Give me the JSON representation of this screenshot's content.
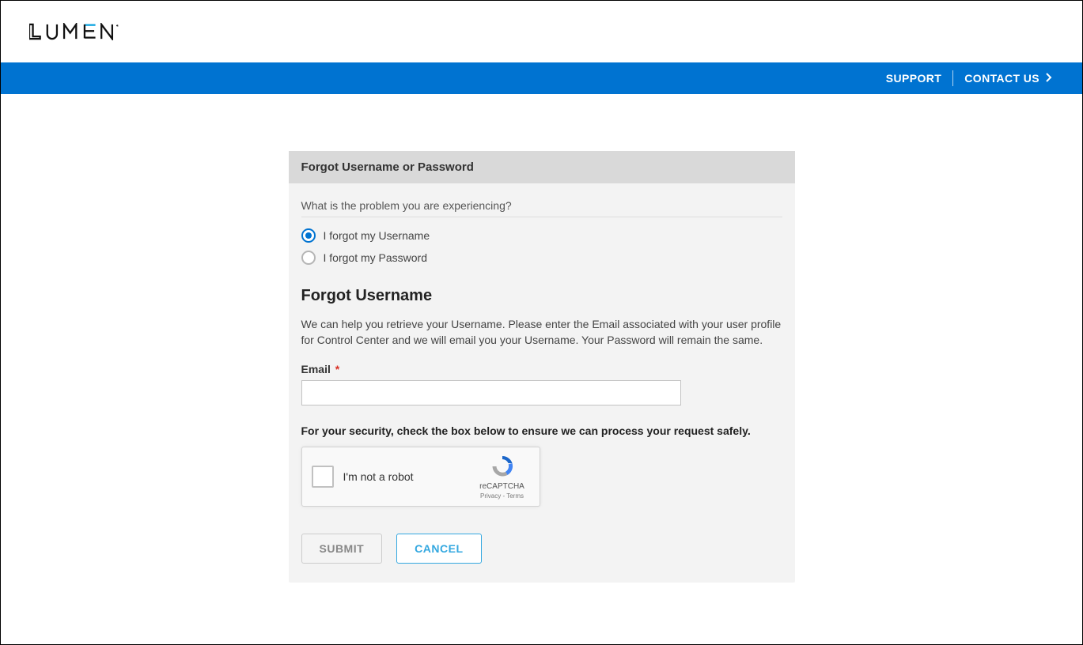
{
  "brand": {
    "name": "LUMEN"
  },
  "nav": {
    "support": "SUPPORT",
    "contact": "CONTACT US"
  },
  "card": {
    "title": "Forgot Username or Password",
    "question": "What is the problem you are experiencing?",
    "options": {
      "forgot_username": "I forgot my Username",
      "forgot_password": "I forgot my Password"
    },
    "section_title": "Forgot Username",
    "help_text": "We can help you retrieve your Username. Please enter the Email associated with your user profile for Control Center and we will email you your Username. Your Password will remain the same.",
    "email": {
      "label": "Email",
      "required_marker": "*",
      "value": ""
    },
    "security_text": "For your security, check the box below to ensure we can process your request safely.",
    "recaptcha": {
      "label": "I'm not a robot",
      "brand": "reCAPTCHA",
      "links": "Privacy - Terms"
    },
    "buttons": {
      "submit": "SUBMIT",
      "cancel": "CANCEL"
    }
  }
}
